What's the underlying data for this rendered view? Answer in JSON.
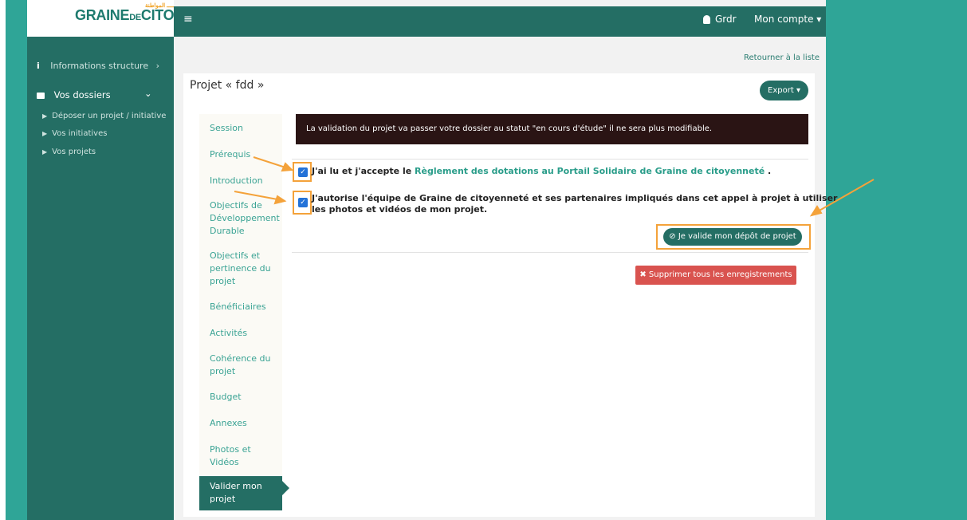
{
  "brand": {
    "logo_main": "GRAINE",
    "logo_sub": "CITOYENNETÉ",
    "logo_small": "DE",
    "logo_tag": "ـــــ المواطنة"
  },
  "topbar": {
    "menu_icon": "hamburger-icon",
    "user_icon": "user-icon",
    "user_name": "Grdr",
    "account_label": "Mon compte ▾"
  },
  "sidebar": {
    "items": [
      {
        "icon": "info-icon",
        "label": "Informations structure",
        "chevron": "›"
      },
      {
        "icon": "briefcase-icon",
        "label": "Vos dossiers",
        "chevron": "⌄"
      },
      {
        "label": "Déposer un projet / initiative"
      },
      {
        "label": "Vos initiatives"
      },
      {
        "label": "Vos projets"
      }
    ]
  },
  "page": {
    "back_link": "Retourner à la liste",
    "title": "Projet « fdd »",
    "export_label": "Export ▾"
  },
  "nav": {
    "items": [
      "Session",
      "Prérequis",
      "Introduction",
      "Objectifs de Développement Durable",
      "Objectifs et pertinence du projet",
      "Bénéficiaires",
      "Activités",
      "Cohérence du projet",
      "Budget",
      "Annexes",
      "Photos et Vidéos"
    ],
    "active": "Valider mon projet"
  },
  "content": {
    "alert": "La validation du projet va passer votre dossier au statut \"en cours d'étude\" il ne sera plus modifiable.",
    "check1_prefix": "J'ai lu et j'accepte le ",
    "check1_link": "Règlement des dotations au Portail Solidaire de Graine de citoyenneté",
    "check1_suffix": " .",
    "check1_checked": true,
    "check2_line1": "J'autorise l'équipe de Graine de citoyenneté et ses partenaires impliqués dans cet appel à projet à utiliser",
    "check2_line2": "les photos et vidéos de mon projet.",
    "check2_checked": true,
    "validate_label": "⊘ Je valide mon dépôt de projet",
    "delete_label": "✖ Supprimer tous les enregistrements"
  },
  "colors": {
    "teal_dark": "#246e64",
    "teal_bg": "#2fa597",
    "alert_bg": "#2a1414",
    "danger": "#d9534f",
    "highlight": "#f4a23a",
    "checkbox": "#2372d8"
  }
}
